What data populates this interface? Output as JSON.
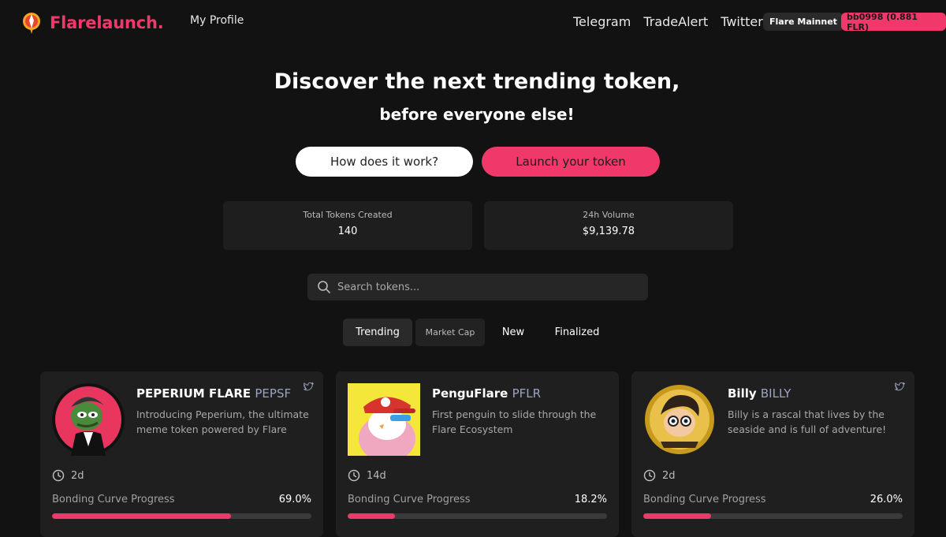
{
  "header": {
    "brand": "Flarelaunch.",
    "my_profile": "My Profile",
    "nav": [
      "Telegram",
      "TradeAlert",
      "Twitter"
    ],
    "network": "Flare Mainnet",
    "wallet": "bb0998 (0.881 FLR)"
  },
  "hero": {
    "title": "Discover the next trending token,",
    "subtitle": "before everyone else!",
    "how_button": "How does it work?",
    "launch_button": "Launch your token"
  },
  "stats": [
    {
      "label": "Total Tokens Created",
      "value": "140"
    },
    {
      "label": "24h Volume",
      "value": "$9,139.78"
    }
  ],
  "search": {
    "placeholder": "Search tokens..."
  },
  "tabs": [
    "Trending",
    "Market Cap",
    "New",
    "Finalized"
  ],
  "cards": [
    {
      "name": "PEPERIUM FLARE",
      "symbol": "PEPSF",
      "desc": "Introducing Peperium, the ultimate meme token powered by Flare",
      "age": "2d",
      "bc_label": "Bonding Curve Progress",
      "bc_value": "69.0%",
      "progress": 0.69
    },
    {
      "name": "PenguFlare",
      "symbol": "PFLR",
      "desc": "First penguin to slide through the Flare Ecosystem",
      "age": "14d",
      "bc_label": "Bonding Curve Progress",
      "bc_value": "18.2%",
      "progress": 0.182
    },
    {
      "name": "Billy",
      "symbol": "BILLY",
      "desc": "Billy is a rascal that lives by the seaside and is full of adventure!",
      "age": "2d",
      "bc_label": "Bonding Curve Progress",
      "bc_value": "26.0%",
      "progress": 0.26
    }
  ],
  "colors": {
    "accent": "#f0386b",
    "background": "#121212",
    "card": "#1f1f1f"
  }
}
